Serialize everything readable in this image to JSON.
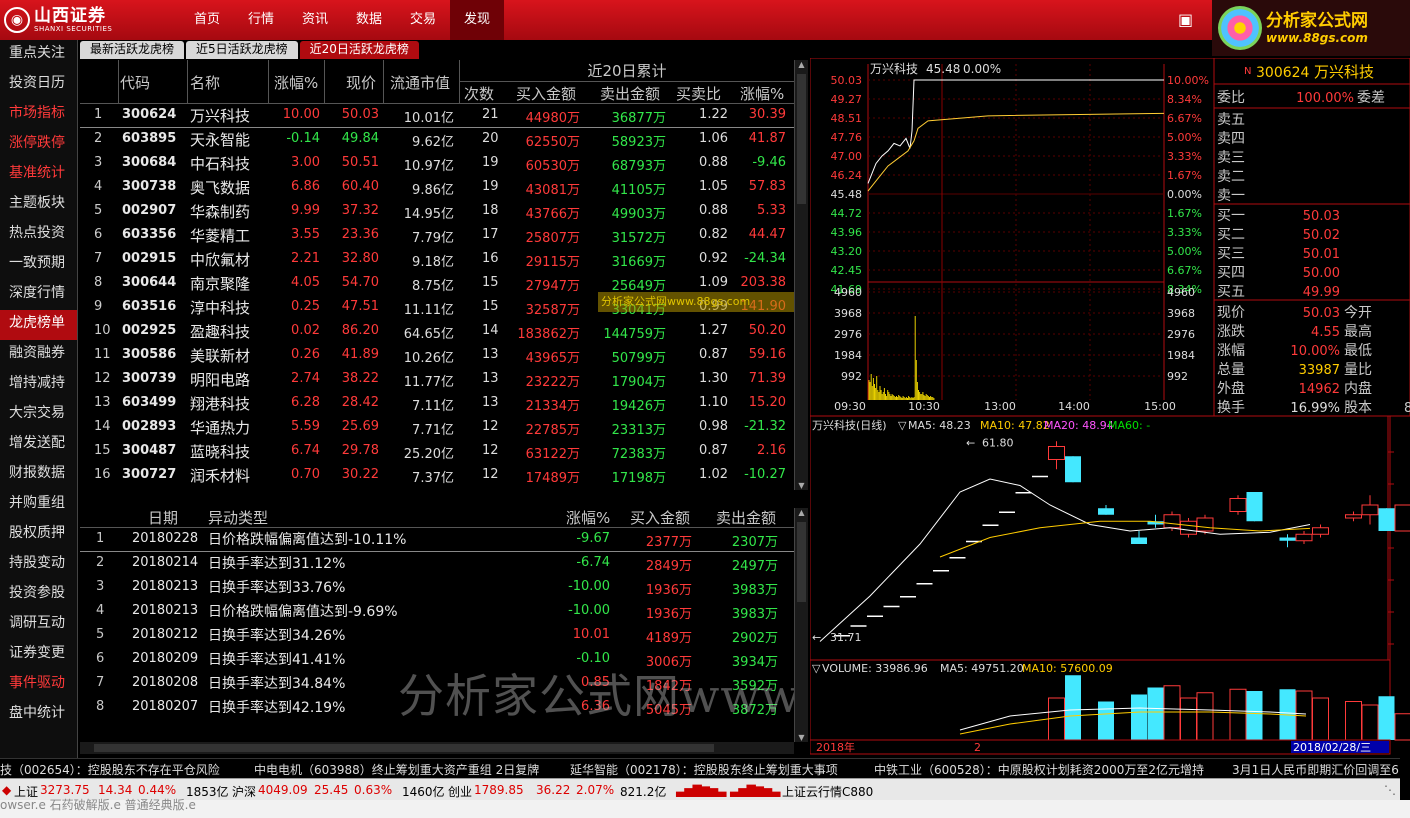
{
  "app": {
    "logo_name": "山西证券",
    "logo_sub": "SHANXI SECURITIES",
    "brand_title": "分析家公式网",
    "brand_url": "www.88gs.com"
  },
  "nav": [
    {
      "label": "首页"
    },
    {
      "label": "行情"
    },
    {
      "label": "资讯"
    },
    {
      "label": "数据"
    },
    {
      "label": "交易"
    },
    {
      "label": "发现",
      "active": true
    }
  ],
  "sidebar": [
    {
      "label": "重点关注"
    },
    {
      "label": "投资日历"
    },
    {
      "label": "市场指标",
      "red": true
    },
    {
      "label": "涨停跌停",
      "red": true
    },
    {
      "label": "基准统计",
      "red": true
    },
    {
      "label": "主题板块"
    },
    {
      "label": "热点投资"
    },
    {
      "label": "一致预期"
    },
    {
      "label": "深度行情"
    },
    {
      "label": "龙虎榜单",
      "active": true
    },
    {
      "label": "融资融券"
    },
    {
      "label": "增持减持"
    },
    {
      "label": "大宗交易"
    },
    {
      "label": "增发送配"
    },
    {
      "label": "财报数据"
    },
    {
      "label": "并购重组"
    },
    {
      "label": "股权质押"
    },
    {
      "label": "持股变动"
    },
    {
      "label": "投资参股"
    },
    {
      "label": "调研互动"
    },
    {
      "label": "证券变更"
    },
    {
      "label": "事件驱动",
      "red": true
    },
    {
      "label": "盘中统计"
    }
  ],
  "tabs": [
    {
      "label": "最新活跃龙虎榜"
    },
    {
      "label": "近5日活跃龙虎榜"
    },
    {
      "label": "近20日活跃龙虎榜",
      "active": true
    }
  ],
  "table": {
    "group_header": "近20日累计",
    "headers": {
      "code": "代码",
      "name": "名称",
      "chg": "涨幅%",
      "price": "现价",
      "cap": "流通市值",
      "cnt": "次数",
      "buy": "买入金额",
      "sell": "卖出金额",
      "ratio": "买卖比",
      "pct": "涨幅%"
    },
    "rows": [
      {
        "idx": "1",
        "code": "300624",
        "name": "万兴科技",
        "chg": "10.00",
        "price": "50.03",
        "cap": "10.01亿",
        "cnt": "21",
        "buy": "44980万",
        "sell": "36877万",
        "ratio": "1.22",
        "pct": "30.39",
        "up": true,
        "pup": true
      },
      {
        "idx": "2",
        "code": "603895",
        "name": "天永智能",
        "chg": "-0.14",
        "price": "49.84",
        "cap": "9.62亿",
        "cnt": "20",
        "buy": "62550万",
        "sell": "58923万",
        "ratio": "1.06",
        "pct": "41.87",
        "up": false,
        "pup": true
      },
      {
        "idx": "3",
        "code": "300684",
        "name": "中石科技",
        "chg": "3.00",
        "price": "50.51",
        "cap": "10.97亿",
        "cnt": "19",
        "buy": "60530万",
        "sell": "68793万",
        "ratio": "0.88",
        "pct": "-9.46",
        "up": true,
        "pup": false
      },
      {
        "idx": "4",
        "code": "300738",
        "name": "奥飞数据",
        "chg": "6.86",
        "price": "60.40",
        "cap": "9.86亿",
        "cnt": "19",
        "buy": "43081万",
        "sell": "41105万",
        "ratio": "1.05",
        "pct": "57.83",
        "up": true,
        "pup": true
      },
      {
        "idx": "5",
        "code": "002907",
        "name": "华森制药",
        "chg": "9.99",
        "price": "37.32",
        "cap": "14.95亿",
        "cnt": "18",
        "buy": "43766万",
        "sell": "49903万",
        "ratio": "0.88",
        "pct": "5.33",
        "up": true,
        "pup": true
      },
      {
        "idx": "6",
        "code": "603356",
        "name": "华菱精工",
        "chg": "3.55",
        "price": "23.36",
        "cap": "7.79亿",
        "cnt": "17",
        "buy": "25807万",
        "sell": "31572万",
        "ratio": "0.82",
        "pct": "44.47",
        "up": true,
        "pup": true
      },
      {
        "idx": "7",
        "code": "002915",
        "name": "中欣氟材",
        "chg": "2.21",
        "price": "32.80",
        "cap": "9.18亿",
        "cnt": "16",
        "buy": "29115万",
        "sell": "31669万",
        "ratio": "0.92",
        "pct": "-24.34",
        "up": true,
        "pup": false
      },
      {
        "idx": "8",
        "code": "300644",
        "name": "南京聚隆",
        "chg": "4.05",
        "price": "54.70",
        "cap": "8.75亿",
        "cnt": "15",
        "buy": "27947万",
        "sell": "25649万",
        "ratio": "1.09",
        "pct": "203.38",
        "up": true,
        "pup": true
      },
      {
        "idx": "9",
        "code": "603516",
        "name": "淳中科技",
        "chg": "0.25",
        "price": "47.51",
        "cap": "11.11亿",
        "cnt": "15",
        "buy": "32587万",
        "sell": "33041万",
        "ratio": "0.99",
        "pct": "141.90",
        "up": true,
        "pup": true
      },
      {
        "idx": "10",
        "code": "002925",
        "name": "盈趣科技",
        "chg": "0.02",
        "price": "86.20",
        "cap": "64.65亿",
        "cnt": "14",
        "buy": "183862万",
        "sell": "144759万",
        "ratio": "1.27",
        "pct": "50.20",
        "up": true,
        "pup": true
      },
      {
        "idx": "11",
        "code": "300586",
        "name": "美联新材",
        "chg": "0.26",
        "price": "41.89",
        "cap": "10.26亿",
        "cnt": "13",
        "buy": "43965万",
        "sell": "50799万",
        "ratio": "0.87",
        "pct": "59.16",
        "up": true,
        "pup": true
      },
      {
        "idx": "12",
        "code": "300739",
        "name": "明阳电路",
        "chg": "2.74",
        "price": "38.22",
        "cap": "11.77亿",
        "cnt": "13",
        "buy": "23222万",
        "sell": "17904万",
        "ratio": "1.30",
        "pct": "71.39",
        "up": true,
        "pup": true
      },
      {
        "idx": "13",
        "code": "603499",
        "name": "翔港科技",
        "chg": "6.28",
        "price": "28.42",
        "cap": "7.11亿",
        "cnt": "13",
        "buy": "21334万",
        "sell": "19426万",
        "ratio": "1.10",
        "pct": "15.20",
        "up": true,
        "pup": true
      },
      {
        "idx": "14",
        "code": "002893",
        "name": "华通热力",
        "chg": "5.59",
        "price": "25.69",
        "cap": "7.71亿",
        "cnt": "12",
        "buy": "22785万",
        "sell": "23313万",
        "ratio": "0.98",
        "pct": "-21.32",
        "up": true,
        "pup": false
      },
      {
        "idx": "15",
        "code": "300487",
        "name": "蓝晓科技",
        "chg": "6.74",
        "price": "29.78",
        "cap": "25.20亿",
        "cnt": "12",
        "buy": "63122万",
        "sell": "72383万",
        "ratio": "0.87",
        "pct": "2.16",
        "up": true,
        "pup": true
      },
      {
        "idx": "16",
        "code": "300727",
        "name": "润禾材料",
        "chg": "0.70",
        "price": "30.22",
        "cap": "7.37亿",
        "cnt": "12",
        "buy": "17489万",
        "sell": "17198万",
        "ratio": "1.02",
        "pct": "-10.27",
        "up": true,
        "pup": false
      }
    ]
  },
  "overlay_watermark_small": "分析家公式网www.88gs.com",
  "detail": {
    "headers": {
      "date": "日期",
      "type": "异动类型",
      "chg": "涨幅%",
      "buy": "买入金额",
      "sell": "卖出金额"
    },
    "rows": [
      {
        "idx": "1",
        "date": "20180228",
        "type": "日价格跌幅偏离值达到-10.11%",
        "chg": "-9.67",
        "buy": "2377万",
        "sell": "2307万",
        "up": false
      },
      {
        "idx": "2",
        "date": "20180214",
        "type": "日换手率达到31.12%",
        "chg": "-6.74",
        "buy": "2849万",
        "sell": "2497万",
        "up": false
      },
      {
        "idx": "3",
        "date": "20180213",
        "type": "日换手率达到33.76%",
        "chg": "-10.00",
        "buy": "1936万",
        "sell": "3983万",
        "up": false
      },
      {
        "idx": "4",
        "date": "20180213",
        "type": "日价格跌幅偏离值达到-9.69%",
        "chg": "-10.00",
        "buy": "1936万",
        "sell": "3983万",
        "up": false
      },
      {
        "idx": "5",
        "date": "20180212",
        "type": "日换手率达到34.26%",
        "chg": "10.01",
        "buy": "4189万",
        "sell": "2902万",
        "up": true
      },
      {
        "idx": "6",
        "date": "20180209",
        "type": "日换手率达到41.41%",
        "chg": "-0.10",
        "buy": "3006万",
        "sell": "3934万",
        "up": false
      },
      {
        "idx": "7",
        "date": "20180208",
        "type": "日换手率达到34.84%",
        "chg": "0.85",
        "buy": "1842万",
        "sell": "3592万",
        "up": true
      },
      {
        "idx": "8",
        "date": "20180207",
        "type": "日换手率达到42.19%",
        "chg": "6.36",
        "buy": "5045万",
        "sell": "3872万",
        "up": true
      }
    ]
  },
  "big_watermark": "分析家公式网www.88gs.com",
  "intraday": {
    "title": "万兴科技",
    "title_price": "45.48",
    "title_pct": "0.00%",
    "price_labels": [
      "50.03",
      "49.27",
      "48.51",
      "47.76",
      "47.00",
      "46.24",
      "45.48",
      "44.72",
      "43.96",
      "43.20",
      "42.45",
      "41.69"
    ],
    "pct_labels": [
      "10.00%",
      "8.34%",
      "6.67%",
      "5.00%",
      "3.33%",
      "1.67%",
      "0.00%",
      "1.67%",
      "3.33%",
      "5.00%",
      "6.67%",
      "8.34%"
    ],
    "vol_labels": [
      "4960",
      "3968",
      "2976",
      "1984",
      "992"
    ],
    "time_labels": [
      "09:30",
      "10:30",
      "13:00",
      "14:00",
      "15:00"
    ]
  },
  "quote": {
    "code": "300624",
    "name": "万兴科技",
    "webi_label": "委比",
    "webi_val": "100.00%",
    "weicha_label": "委差",
    "sell_labels": [
      "卖五",
      "卖四",
      "卖三",
      "卖二",
      "卖一"
    ],
    "buy": [
      {
        "label": "买一",
        "price": "50.03"
      },
      {
        "label": "买二",
        "price": "50.02"
      },
      {
        "label": "买三",
        "price": "50.01"
      },
      {
        "label": "买四",
        "price": "50.00"
      },
      {
        "label": "买五",
        "price": "49.99"
      }
    ],
    "stats": [
      {
        "label": "现价",
        "val": "50.03",
        "label2": "今开",
        "color": "red"
      },
      {
        "label": "涨跌",
        "val": "4.55",
        "label2": "最高",
        "color": "red"
      },
      {
        "label": "涨幅",
        "val": "10.00%",
        "label2": "最低",
        "color": "red"
      },
      {
        "label": "总量",
        "val": "33987",
        "label2": "量比",
        "color": "yellow"
      },
      {
        "label": "外盘",
        "val": "14962",
        "label2": "内盘",
        "color": "red"
      },
      {
        "label": "换手",
        "val": "16.99%",
        "label2": "股本",
        "color": "white"
      }
    ],
    "stat_extra": "8"
  },
  "kline": {
    "title": "万兴科技(日线)",
    "ma5": "MA5: 48.23",
    "ma10": "MA10: 47.82",
    "ma20": "MA20: 48.94",
    "ma60": "MA60: -",
    "high_label": "61.80",
    "low_label": "31.71",
    "vol_title": "VOLUME: 33986.96",
    "vol_ma5": "MA5: 49751.20",
    "vol_ma10": "MA10: 57600.09",
    "date_left": "2018年",
    "date_mid": "2",
    "date_right": "2018/02/28/三",
    "candles": [
      {
        "o": 32,
        "c": 32,
        "h": 32,
        "l": 32
      },
      {
        "o": 33.5,
        "c": 33.5,
        "h": 33.5,
        "l": 33.5
      },
      {
        "o": 35,
        "c": 35,
        "h": 35,
        "l": 35
      },
      {
        "o": 36.5,
        "c": 36.5,
        "h": 36.5,
        "l": 36.5
      },
      {
        "o": 38,
        "c": 38,
        "h": 38,
        "l": 38
      },
      {
        "o": 40,
        "c": 40,
        "h": 40,
        "l": 40
      },
      {
        "o": 42,
        "c": 42,
        "h": 42,
        "l": 42
      },
      {
        "o": 44,
        "c": 44,
        "h": 44,
        "l": 44
      },
      {
        "o": 46.5,
        "c": 46.5,
        "h": 46.5,
        "l": 46.5
      },
      {
        "o": 49,
        "c": 49,
        "h": 49,
        "l": 49
      },
      {
        "o": 51,
        "c": 51,
        "h": 51,
        "l": 51
      },
      {
        "o": 54,
        "c": 54,
        "h": 54,
        "l": 54
      },
      {
        "o": 56.5,
        "c": 56.5,
        "h": 56.5,
        "l": 56.5
      },
      {
        "o": 59,
        "c": 61,
        "h": 61.8,
        "l": 57.5
      },
      {
        "o": 59.5,
        "c": 55.5,
        "h": 59.5,
        "l": 55.5
      },
      {
        "o": 0,
        "c": 0,
        "h": 0,
        "l": 0
      },
      {
        "o": 51.5,
        "c": 50.5,
        "h": 52,
        "l": 50.5
      },
      {
        "o": 0,
        "c": 0,
        "h": 0,
        "l": 0
      },
      {
        "o": 47,
        "c": 46,
        "h": 48,
        "l": 46
      },
      {
        "o": 49.5,
        "c": 49,
        "h": 50.5,
        "l": 48.5
      },
      {
        "o": 48.5,
        "c": 50.5,
        "h": 51,
        "l": 48
      },
      {
        "o": 47.5,
        "c": 49.5,
        "h": 50,
        "l": 47
      },
      {
        "o": 48,
        "c": 50,
        "h": 50.5,
        "l": 47.5
      },
      {
        "o": 0,
        "c": 0,
        "h": 0,
        "l": 0
      },
      {
        "o": 51,
        "c": 53,
        "h": 53.5,
        "l": 50.5
      },
      {
        "o": 54,
        "c": 49.5,
        "h": 54,
        "l": 49.5
      },
      {
        "o": 0,
        "c": 0,
        "h": 0,
        "l": 0
      },
      {
        "o": 47,
        "c": 46.5,
        "h": 47.5,
        "l": 45.5
      },
      {
        "o": 46.5,
        "c": 47.5,
        "h": 48,
        "l": 46
      },
      {
        "o": 47.5,
        "c": 48.5,
        "h": 49,
        "l": 47
      },
      {
        "o": 0,
        "c": 0,
        "h": 0,
        "l": 0
      },
      {
        "o": 50,
        "c": 50.5,
        "h": 51,
        "l": 49.5
      },
      {
        "o": 50.5,
        "c": 52,
        "h": 53.5,
        "l": 49
      },
      {
        "o": 51.5,
        "c": 48,
        "h": 51.5,
        "l": 48
      },
      {
        "o": 48,
        "c": 52,
        "h": 52,
        "l": 48
      }
    ],
    "volumes": [
      0,
      0,
      0,
      0,
      0,
      0,
      0,
      0,
      0,
      0,
      0,
      0,
      0,
      48000,
      74000,
      0,
      44000,
      0,
      52000,
      60000,
      62000,
      48000,
      54000,
      0,
      58000,
      56000,
      0,
      58000,
      56000,
      48000,
      0,
      44000,
      40000,
      50000,
      30000
    ]
  },
  "ticker": [
    {
      "text": "技（002654）：控股股东不存在平仓风险"
    },
    {
      "text": "中电电机（603988）终止筹划重大资产重组 2日复牌"
    },
    {
      "text": "延华智能（002178）：控股股东终止筹划重大事项"
    },
    {
      "text": "中铁工业（600528）：中原股权计划耗资2000万至2亿元增持"
    },
    {
      "text": "3月1日人民币即期汇价回调至6."
    }
  ],
  "status": {
    "sh_label": "上证",
    "sh_val": "3273.75",
    "sh_chg": "14.34",
    "sh_pct": "0.44%",
    "sh_amt": "1853亿",
    "hs_label": "沪深",
    "hs_val": "4049.09",
    "hs_chg": "25.45",
    "hs_pct": "0.63%",
    "hs_amt": "1460亿",
    "cy_label": "创业",
    "cy_val": "1789.85",
    "cy_chg": "36.22",
    "cy_pct": "2.07%",
    "cy_amt": "821.2亿",
    "cloud": "上证云行情C880"
  },
  "bottom_overlap": "owser.e   石药破解版.e   普通经典版.e"
}
